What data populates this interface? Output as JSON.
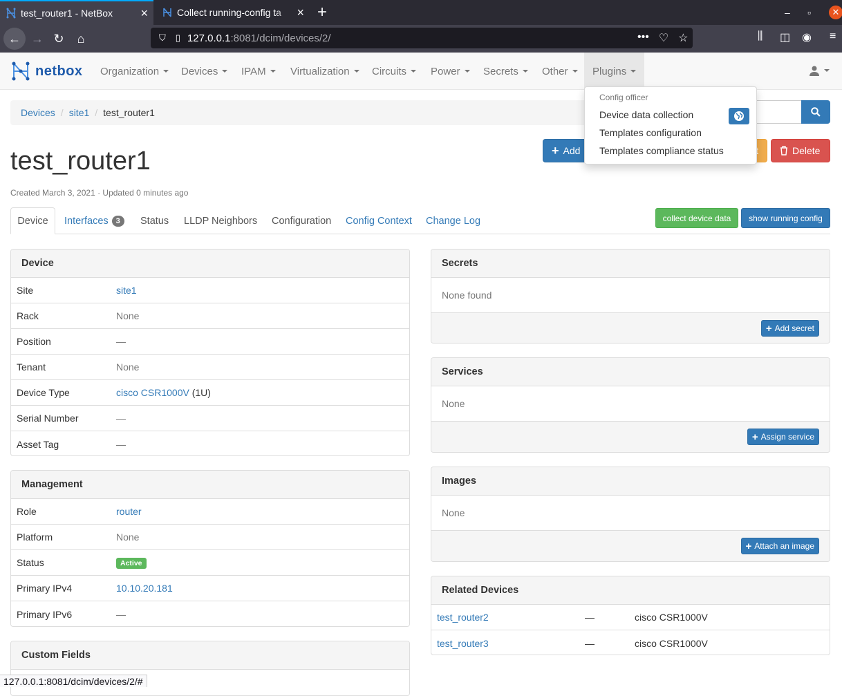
{
  "browser": {
    "tabs": [
      {
        "title": "test_router1 - NetBox"
      },
      {
        "title": "Collect running-config ta"
      }
    ],
    "url_host": "127.0.0.1",
    "url_rest": ":8081/dcim/devices/2/",
    "status_url": "127.0.0.1:8081/dcim/devices/2/#"
  },
  "nav": {
    "logo": "netbox",
    "menus": [
      "Organization",
      "Devices",
      "IPAM",
      "Virtualization",
      "Circuits",
      "Power",
      "Secrets",
      "Other",
      "Plugins"
    ]
  },
  "dropdown": {
    "header": "Config officer",
    "items": [
      "Device data collection",
      "Templates configuration",
      "Templates compliance status"
    ]
  },
  "breadcrumb": [
    "Devices",
    "site1",
    "test_router1"
  ],
  "page": {
    "title": "test_router1",
    "created": "Created March 3, 2021 · Updated 0 minutes ago",
    "add_label": "Add",
    "edit_label": "t",
    "delete_label": "Delete"
  },
  "tabs": {
    "device": "Device",
    "interfaces": "Interfaces",
    "interfaces_count": "3",
    "status": "Status",
    "lldp": "LLDP Neighbors",
    "configuration": "Configuration",
    "config_context": "Config Context",
    "change_log": "Change Log",
    "collect_btn": "collect device data",
    "showrun_btn": "show running config"
  },
  "device_panel": {
    "heading": "Device",
    "rows": [
      {
        "k": "Site",
        "v": "site1"
      },
      {
        "k": "Rack",
        "v": "None"
      },
      {
        "k": "Position",
        "v": "—"
      },
      {
        "k": "Tenant",
        "v": "None"
      },
      {
        "k": "Device Type",
        "v": "cisco CSR1000V",
        "extra": "(1U)"
      },
      {
        "k": "Serial Number",
        "v": "—"
      },
      {
        "k": "Asset Tag",
        "v": "—"
      }
    ]
  },
  "management_panel": {
    "heading": "Management",
    "rows": [
      {
        "k": "Role",
        "v": "router"
      },
      {
        "k": "Platform",
        "v": "None"
      },
      {
        "k": "Status",
        "v": "Active"
      },
      {
        "k": "Primary IPv4",
        "v": "10.10.20.181"
      },
      {
        "k": "Primary IPv6",
        "v": "—"
      }
    ]
  },
  "custom_fields": {
    "heading": "Custom Fields"
  },
  "secrets": {
    "heading": "Secrets",
    "body": "None found",
    "button": "Add secret"
  },
  "services": {
    "heading": "Services",
    "body": "None",
    "button": "Assign service"
  },
  "images": {
    "heading": "Images",
    "body": "None",
    "button": "Attach an image"
  },
  "related": {
    "heading": "Related Devices",
    "rows": [
      {
        "name": "test_router2",
        "dash": "—",
        "type": "cisco CSR1000V"
      },
      {
        "name": "test_router3",
        "dash": "—",
        "type": "cisco CSR1000V"
      }
    ]
  },
  "colors": {
    "primary": "#337ab7",
    "success": "#5cb85c",
    "danger": "#d9534f",
    "warning": "#f0ad4e"
  }
}
